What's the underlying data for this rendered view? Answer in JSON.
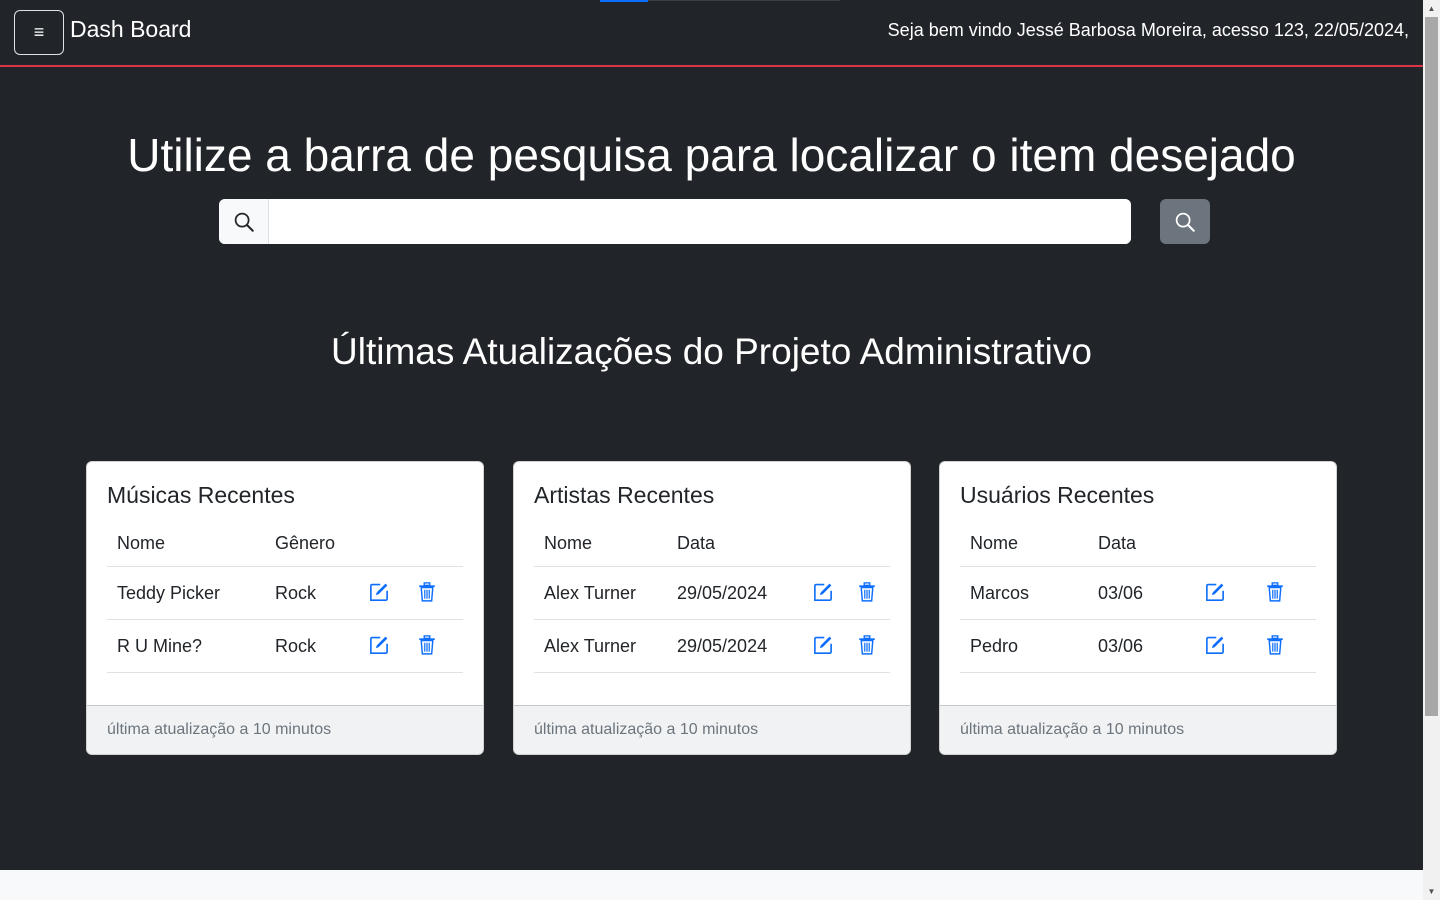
{
  "navbar": {
    "menu_icon": "hamburger-icon",
    "menu_glyph": "≡",
    "brand": "Dash Board",
    "welcome": "Seja bem vindo Jessé Barbosa Moreira, acesso 123, 22/05/2024,"
  },
  "hero": {
    "title": "Utilize a barra de pesquisa para localizar o item desejado",
    "search_icon": "search-icon",
    "search_placeholder": "",
    "search_value": "",
    "search_button_icon": "search-icon"
  },
  "section": {
    "title": "Últimas Atualizações do Projeto Administrativo"
  },
  "colors": {
    "background": "#212529",
    "accent_border": "#dc3545",
    "action_icon": "#0d6efd",
    "search_button": "#6c757d"
  },
  "cards": [
    {
      "title": "Músicas Recentes",
      "headers": [
        "Nome",
        "Gênero"
      ],
      "rows": [
        {
          "c1": "Teddy Picker",
          "c2": "Rock"
        },
        {
          "c1": "R U Mine?",
          "c2": "Rock"
        }
      ],
      "footer": "última atualização a 10 minutos"
    },
    {
      "title": "Artistas Recentes",
      "headers": [
        "Nome",
        "Data"
      ],
      "rows": [
        {
          "c1": "Alex Turner",
          "c2": "29/05/2024"
        },
        {
          "c1": "Alex Turner",
          "c2": "29/05/2024"
        }
      ],
      "footer": "última atualização a 10 minutos"
    },
    {
      "title": "Usuários Recentes",
      "headers": [
        "Nome",
        "Data"
      ],
      "rows": [
        {
          "c1": "Marcos",
          "c2": "03/06"
        },
        {
          "c1": "Pedro",
          "c2": "03/06"
        }
      ],
      "footer": "última atualização a 10 minutos"
    }
  ],
  "row_actions": {
    "edit_icon": "edit-icon",
    "delete_icon": "trash-icon"
  }
}
